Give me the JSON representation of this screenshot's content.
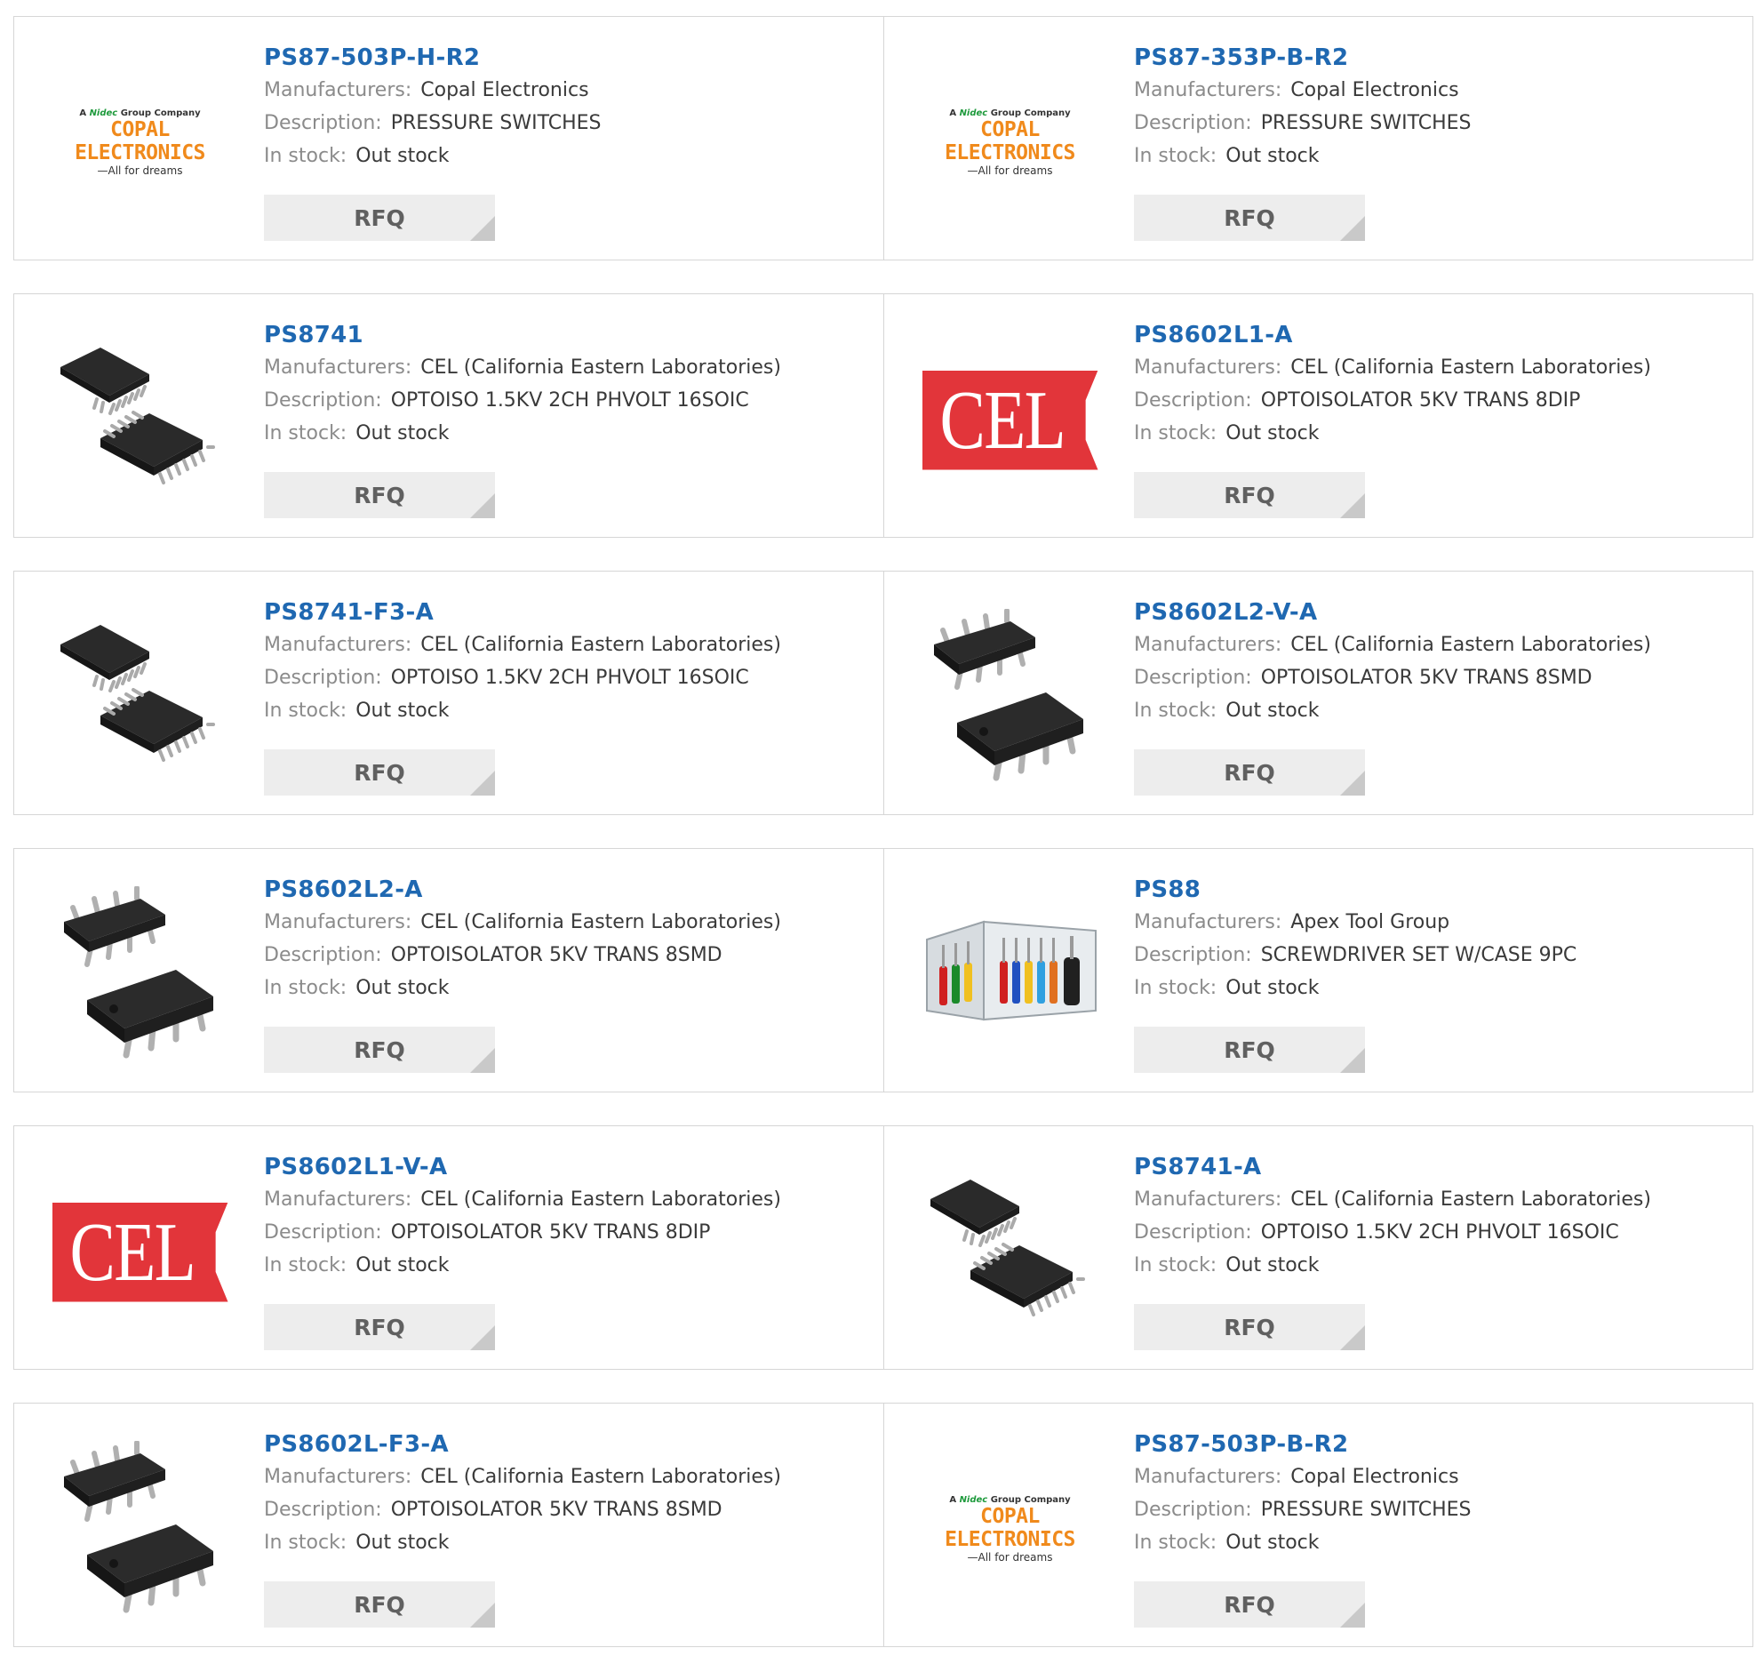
{
  "labels": {
    "manufacturers": "Manufacturers:",
    "description": "Description:",
    "in_stock": "In stock:",
    "rfq": "RFQ"
  },
  "logo_text": {
    "copal_top_prefix": "A",
    "copal_top_nidec": "Nidec",
    "copal_top_suffix": "Group Company",
    "copal_brand": "COPAL ELECTRONICS",
    "copal_tag": "—All for dreams",
    "cel": "CEL"
  },
  "colors": {
    "part_link": "#1f68b1",
    "copal_orange": "#f08a1c",
    "cel_red": "#e2353a",
    "rfq_bg": "#ededed"
  },
  "products": [
    {
      "part": "PS87-503P-H-R2",
      "manufacturer": "Copal Electronics",
      "description": "PRESSURE SWITCHES",
      "stock": "Out stock",
      "image": "copal-logo"
    },
    {
      "part": "PS87-353P-B-R2",
      "manufacturer": "Copal Electronics",
      "description": "PRESSURE SWITCHES",
      "stock": "Out stock",
      "image": "copal-logo"
    },
    {
      "part": "PS8741",
      "manufacturer": "CEL (California Eastern Laboratories)",
      "description": "OPTOISO 1.5KV 2CH PHVOLT 16SOIC",
      "stock": "Out stock",
      "image": "soic16-chip"
    },
    {
      "part": "PS8602L1-A",
      "manufacturer": "CEL (California Eastern Laboratories)",
      "description": "OPTOISOLATOR 5KV TRANS 8DIP",
      "stock": "Out stock",
      "image": "cel-logo"
    },
    {
      "part": "PS8741-F3-A",
      "manufacturer": "CEL (California Eastern Laboratories)",
      "description": "OPTOISO 1.5KV 2CH PHVOLT 16SOIC",
      "stock": "Out stock",
      "image": "soic16-chip"
    },
    {
      "part": "PS8602L2-V-A",
      "manufacturer": "CEL (California Eastern Laboratories)",
      "description": "OPTOISOLATOR 5KV TRANS 8SMD",
      "stock": "Out stock",
      "image": "smd8-chip"
    },
    {
      "part": "PS8602L2-A",
      "manufacturer": "CEL (California Eastern Laboratories)",
      "description": "OPTOISOLATOR 5KV TRANS 8SMD",
      "stock": "Out stock",
      "image": "smd8-chip"
    },
    {
      "part": "PS88",
      "manufacturer": "Apex Tool Group",
      "description": "SCREWDRIVER SET W/CASE 9PC",
      "stock": "Out stock",
      "image": "screwdriver-set"
    },
    {
      "part": "PS8602L1-V-A",
      "manufacturer": "CEL (California Eastern Laboratories)",
      "description": "OPTOISOLATOR 5KV TRANS 8DIP",
      "stock": "Out stock",
      "image": "cel-logo"
    },
    {
      "part": "PS8741-A",
      "manufacturer": "CEL (California Eastern Laboratories)",
      "description": "OPTOISO 1.5KV 2CH PHVOLT 16SOIC",
      "stock": "Out stock",
      "image": "soic16-chip"
    },
    {
      "part": "PS8602L-F3-A",
      "manufacturer": "CEL (California Eastern Laboratories)",
      "description": "OPTOISOLATOR 5KV TRANS 8SMD",
      "stock": "Out stock",
      "image": "smd8-chip"
    },
    {
      "part": "PS87-503P-B-R2",
      "manufacturer": "Copal Electronics",
      "description": "PRESSURE SWITCHES",
      "stock": "Out stock",
      "image": "copal-logo"
    }
  ]
}
